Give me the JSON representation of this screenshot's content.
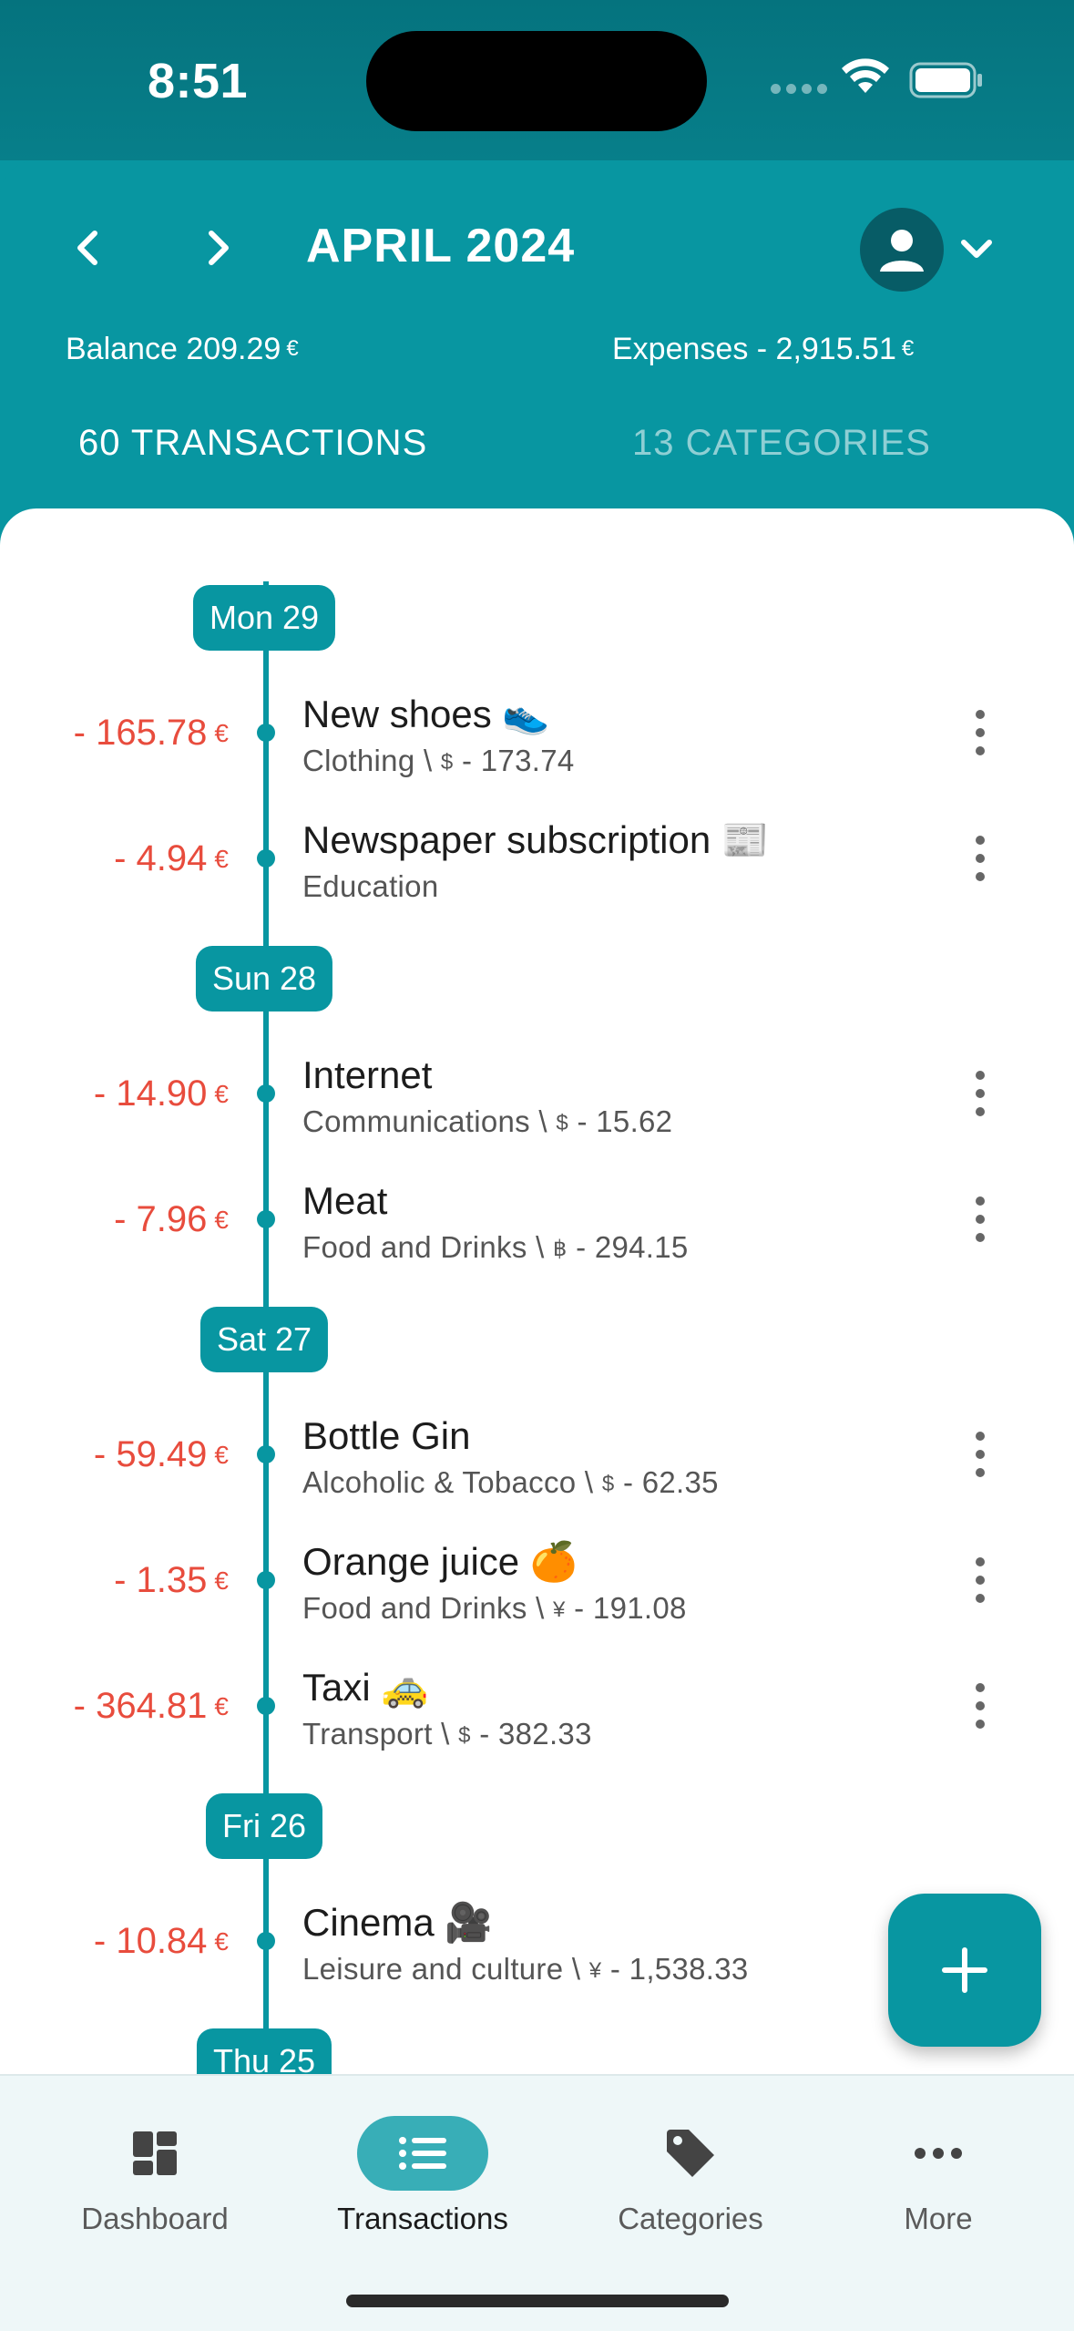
{
  "status_bar": {
    "time": "8:51"
  },
  "header": {
    "month": "APRIL 2024",
    "balance_label": "Balance 209.29",
    "balance_currency": "€",
    "expenses_label": "Expenses - 2,915.51",
    "expenses_currency": "€",
    "tabs": [
      {
        "label": "60 TRANSACTIONS",
        "active": true
      },
      {
        "label": "13 CATEGORIES",
        "active": false
      }
    ]
  },
  "days": [
    {
      "label": "Mon 29"
    },
    {
      "label": "Sun 28"
    },
    {
      "label": "Sat 27"
    },
    {
      "label": "Fri 26"
    },
    {
      "label": "Thu 25"
    }
  ],
  "transactions": [
    {
      "amount": "- 165.78",
      "currency": "€",
      "title": "New shoes 👟",
      "category": "Clothing \\",
      "orig_symbol": "$",
      "orig_amount": "- 173.74"
    },
    {
      "amount": "- 4.94",
      "currency": "€",
      "title": "Newspaper subscription 📰",
      "category": "Education",
      "orig_symbol": "",
      "orig_amount": ""
    },
    {
      "amount": "- 14.90",
      "currency": "€",
      "title": "Internet",
      "category": "Communications \\",
      "orig_symbol": "$",
      "orig_amount": "- 15.62"
    },
    {
      "amount": "- 7.96",
      "currency": "€",
      "title": "Meat",
      "category": "Food and Drinks \\",
      "orig_symbol": "฿",
      "orig_amount": "- 294.15"
    },
    {
      "amount": "- 59.49",
      "currency": "€",
      "title": "Bottle Gin",
      "category": "Alcoholic & Tobacco \\",
      "orig_symbol": "$",
      "orig_amount": "- 62.35"
    },
    {
      "amount": "- 1.35",
      "currency": "€",
      "title": "Orange juice 🍊",
      "category": "Food and Drinks \\",
      "orig_symbol": "¥",
      "orig_amount": "- 191.08"
    },
    {
      "amount": "- 364.81",
      "currency": "€",
      "title": "Taxi 🚕",
      "category": "Transport \\",
      "orig_symbol": "$",
      "orig_amount": "- 382.33"
    },
    {
      "amount": "- 10.84",
      "currency": "€",
      "title": "Cinema 🎥",
      "category": "Leisure and culture \\",
      "orig_symbol": "¥",
      "orig_amount": "- 1,538.33"
    }
  ],
  "bottom_nav": [
    {
      "label": "Dashboard",
      "icon": "dashboard-icon",
      "active": false
    },
    {
      "label": "Transactions",
      "icon": "list-icon",
      "active": true
    },
    {
      "label": "Categories",
      "icon": "tag-icon",
      "active": false
    },
    {
      "label": "More",
      "icon": "more-horizontal-icon",
      "active": false
    }
  ],
  "colors": {
    "accent": "#0896a1",
    "expense": "#e84c3d"
  }
}
